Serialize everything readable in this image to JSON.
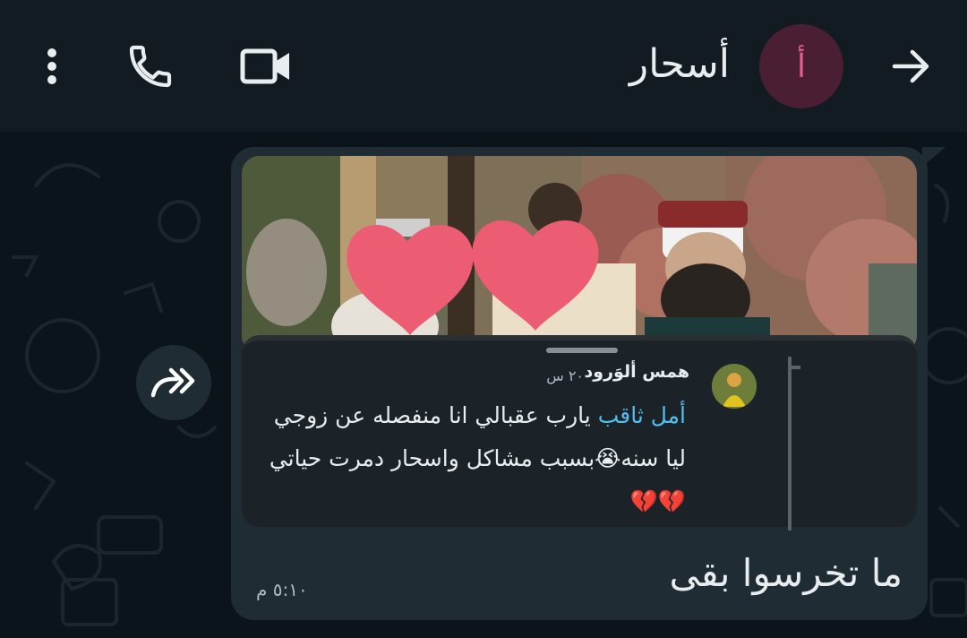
{
  "header": {
    "contact_name": "أسحار",
    "avatar_letter": "أ",
    "icons": {
      "menu": "more-vertical-icon",
      "call": "phone-icon",
      "video": "video-camera-icon",
      "back": "arrow-right-icon"
    }
  },
  "message": {
    "quoted": {
      "sender": "همس ألوَرود",
      "time": "٢٠ س",
      "mention": "أمل ثاقب",
      "text": "يارب عقبالي انا منفصله عن زوجي ليا سنه😭بسبب مشاكل واسحار دمرت حياتي💔💔"
    },
    "text": "ما تخرسوا بقى",
    "time": "٥:١٠ م"
  },
  "colors": {
    "header_bg": "#111b21",
    "chat_bg": "#0b141a",
    "bubble_bg": "#202c33",
    "mention": "#53bdeb",
    "avatar_bg": "#4a1f33"
  }
}
